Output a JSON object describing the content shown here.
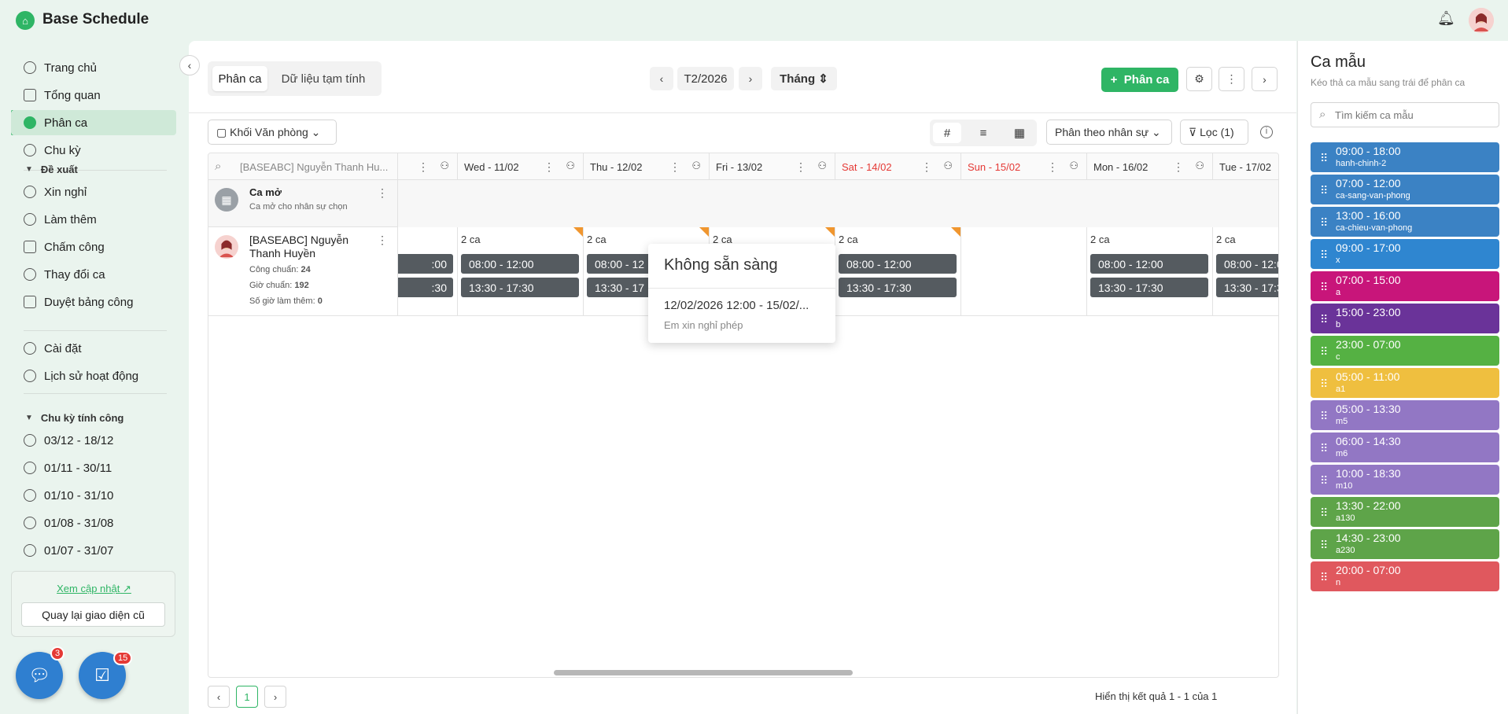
{
  "app": {
    "brand": "Base Schedule"
  },
  "sidebar": {
    "items": [
      "Trang chủ",
      "Tổng quan",
      "Phân ca",
      "Chu kỳ"
    ],
    "proposal_title": "Đề xuất",
    "proposal_items": [
      "Xin nghỉ",
      "Làm thêm",
      "Chấm công",
      "Thay đổi ca",
      "Duyệt bảng công"
    ],
    "settings_items": [
      "Cài đặt",
      "Lịch sử hoạt động"
    ],
    "cycle_title": "Chu kỳ tính công",
    "cycles": [
      "03/12 - 18/12",
      "01/11 - 30/11",
      "01/10 - 31/10",
      "01/08 - 31/08",
      "01/07 - 31/07"
    ],
    "update_link": "Xem cập nhật",
    "old_ui_button": "Quay lại giao diện cũ",
    "chat_badge": "3",
    "task_badge": "15"
  },
  "main": {
    "tabs": [
      "Phân ca",
      "Dữ liệu tạm tính"
    ],
    "period": "T2/2026",
    "mode": "Tháng",
    "add_button": "Phân ca",
    "department": "Khối Văn phòng",
    "group_by": "Phân theo nhân sự",
    "filter": "Lọc (1)",
    "search_text": "[BASEABC] Nguyễn Thanh Hu...",
    "days": [
      {
        "label": "Wed - 11/02",
        "weekend": false
      },
      {
        "label": "Thu - 12/02",
        "weekend": false
      },
      {
        "label": "Fri - 13/02",
        "weekend": false
      },
      {
        "label": "Sat - 14/02",
        "weekend": true
      },
      {
        "label": "Sun - 15/02",
        "weekend": true
      },
      {
        "label": "Mon - 16/02",
        "weekend": false
      },
      {
        "label": "Tue - 17/02",
        "weekend": false
      }
    ],
    "open_shift": {
      "title": "Ca mở",
      "subtitle": "Ca mở cho nhân sự chọn"
    },
    "employee": {
      "name_line1": "[BASEABC] Nguyễn",
      "name_line2": "Thanh Huyền",
      "std_days_label": "Công chuẩn:",
      "std_days": "24",
      "std_hours_label": "Giờ chuẩn:",
      "std_hours": "192",
      "ot_label": "Số giờ làm thêm:",
      "ot": "0"
    },
    "shift_count": "2 ca",
    "shift_count_partial": "2 ca",
    "shift_morning": "08:00 - 12:00",
    "shift_afternoon": "13:30 - 17:30",
    "shift_morning_partial": "08:00 - 12",
    "shift_afternoon_partial": "13:30 - 17",
    "shift_morning_tail": ":00",
    "shift_afternoon_tail": ":30",
    "popup": {
      "title": "Không sẵn sàng",
      "range": "12/02/2026 12:00 - 15/02/...",
      "note": "Em xin nghỉ phép"
    },
    "page": "1",
    "result_text": "Hiển thị kết quả 1 - 1 của 1"
  },
  "templates": {
    "title": "Ca mẫu",
    "subtitle": "Kéo thả ca mẫu sang trái để phân ca",
    "search_placeholder": "Tìm kiếm ca mẫu",
    "items": [
      {
        "time": "09:00 - 18:00",
        "code": "hanh-chinh-2",
        "color": "#3b82c4"
      },
      {
        "time": "07:00 - 12:00",
        "code": "ca-sang-van-phong",
        "color": "#3b82c4"
      },
      {
        "time": "13:00 - 16:00",
        "code": "ca-chieu-van-phong",
        "color": "#3b82c4"
      },
      {
        "time": "09:00 - 17:00",
        "code": "x",
        "color": "#2f86d0"
      },
      {
        "time": "07:00 - 15:00",
        "code": "a",
        "color": "#c8157a"
      },
      {
        "time": "15:00 - 23:00",
        "code": "b",
        "color": "#6a3399"
      },
      {
        "time": "23:00 - 07:00",
        "code": "c",
        "color": "#55b143"
      },
      {
        "time": "05:00 - 11:00",
        "code": "a1",
        "color": "#efbf3f"
      },
      {
        "time": "05:00 - 13:30",
        "code": "m5",
        "color": "#9277c4"
      },
      {
        "time": "06:00 - 14:30",
        "code": "m6",
        "color": "#9277c4"
      },
      {
        "time": "10:00 - 18:30",
        "code": "m10",
        "color": "#9277c4"
      },
      {
        "time": "13:30 - 22:00",
        "code": "a130",
        "color": "#5ea449"
      },
      {
        "time": "14:30 - 23:00",
        "code": "a230",
        "color": "#5ea449"
      },
      {
        "time": "20:00 - 07:00",
        "code": "n",
        "color": "#e0585e"
      }
    ]
  }
}
